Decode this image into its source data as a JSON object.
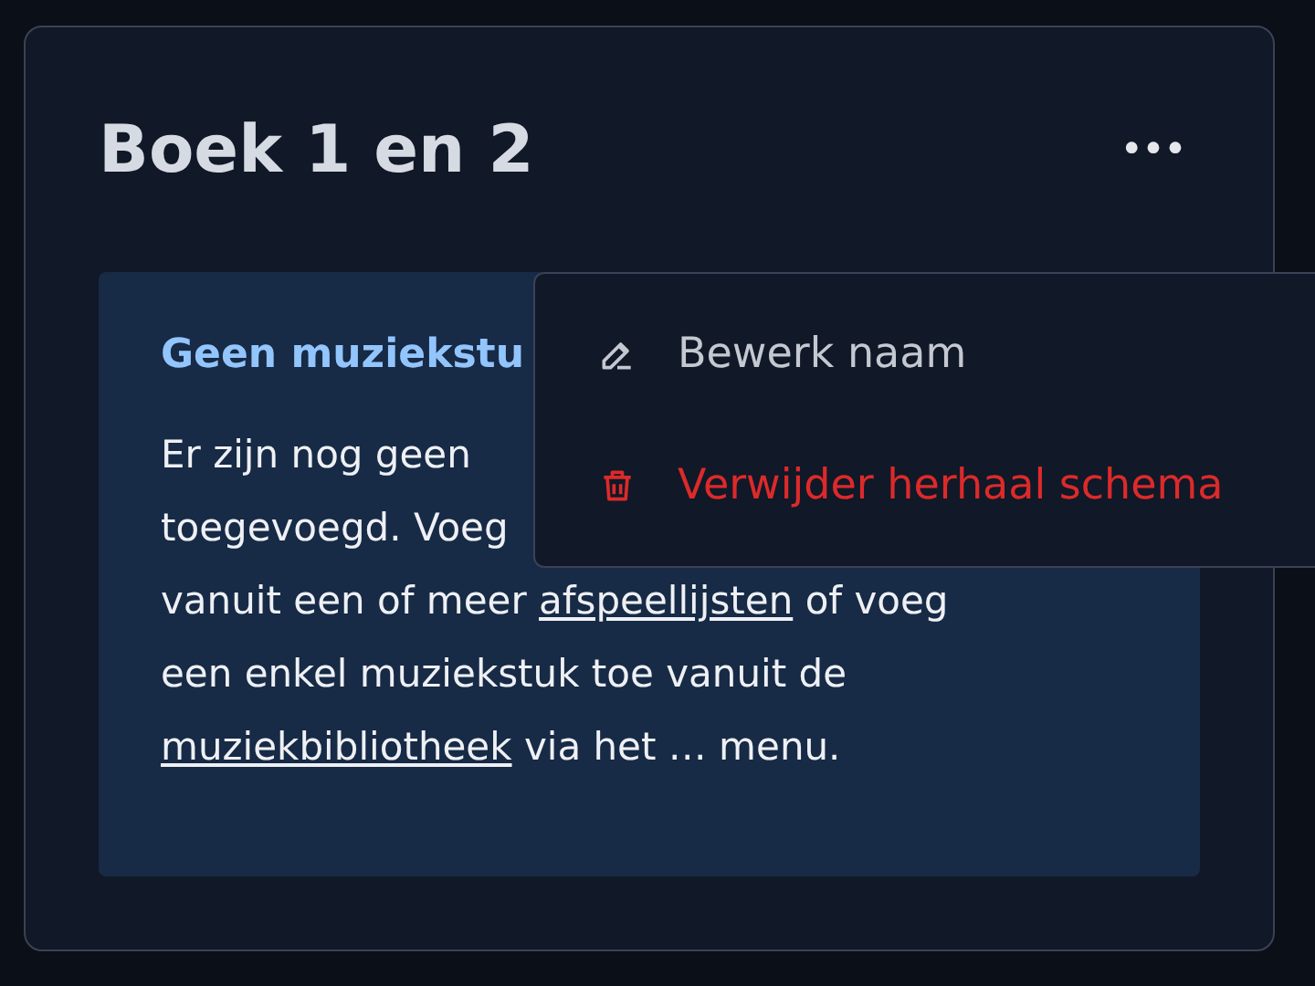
{
  "card": {
    "title": "Boek 1 en 2",
    "more_button": "•••"
  },
  "notice": {
    "title": "Geen muziekstu",
    "lines": [
      [
        {
          "kind": "text",
          "text": "Er zijn nog geen"
        }
      ],
      [
        {
          "kind": "text",
          "text": "toegevoegd. Voeg"
        }
      ],
      [
        {
          "kind": "text",
          "text": "vanuit een of meer "
        },
        {
          "kind": "link",
          "text": "afspeellijsten"
        },
        {
          "kind": "text",
          "text": " of voeg"
        }
      ],
      [
        {
          "kind": "text",
          "text": "een enkel muziekstuk toe vanuit de"
        }
      ],
      [
        {
          "kind": "link",
          "text": "muziekbibliotheek"
        },
        {
          "kind": "text",
          "text": " via het … menu."
        }
      ]
    ]
  },
  "menu": {
    "items": [
      {
        "kind": "edit",
        "label": "Bewerk naam",
        "danger": false
      },
      {
        "kind": "delete",
        "label": "Verwijder herhaal schema",
        "danger": true
      }
    ]
  }
}
